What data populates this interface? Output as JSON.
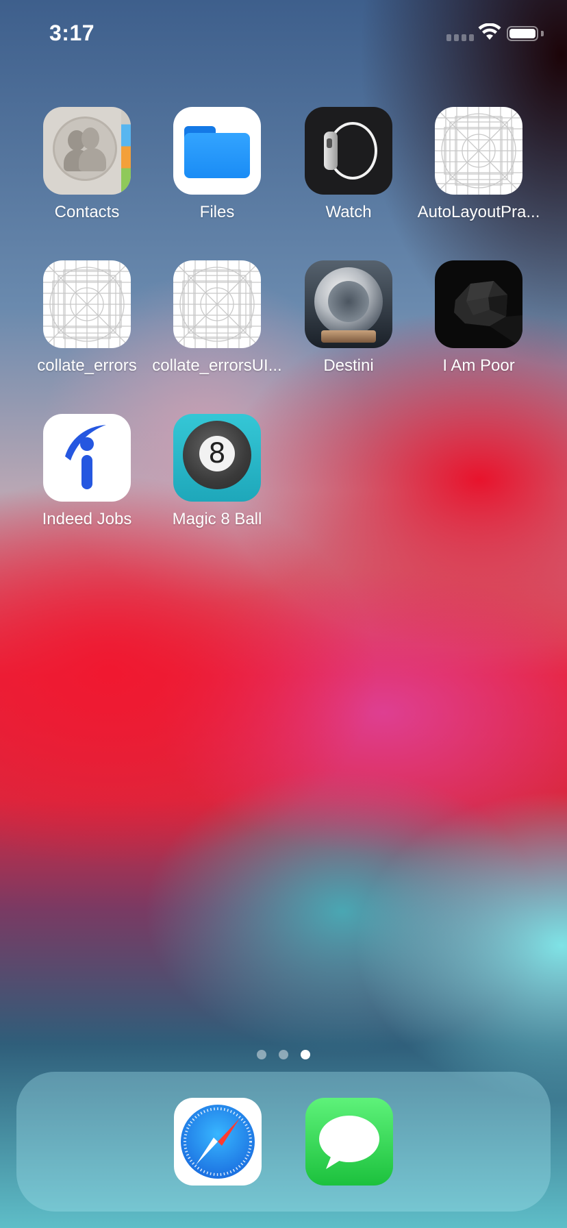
{
  "status_bar": {
    "time": "3:17",
    "battery_level": 1.0
  },
  "home": {
    "page_count": 3,
    "active_page": 3,
    "apps": [
      {
        "label": "Contacts",
        "icon": "contacts-icon"
      },
      {
        "label": "Files",
        "icon": "files-folder-icon"
      },
      {
        "label": "Watch",
        "icon": "watch-icon"
      },
      {
        "label": "AutoLayoutPra...",
        "icon": "placeholder-grid-icon"
      },
      {
        "label": "collate_errors",
        "icon": "placeholder-grid-icon"
      },
      {
        "label": "collate_errorsUI...",
        "icon": "placeholder-grid-icon"
      },
      {
        "label": "Destini",
        "icon": "crystal-ball-icon"
      },
      {
        "label": "I Am Poor",
        "icon": "coal-rock-icon"
      },
      {
        "label": "Indeed Jobs",
        "icon": "indeed-icon"
      },
      {
        "label": "Magic 8 Ball",
        "icon": "magic-8-ball-icon"
      }
    ]
  },
  "dock": {
    "apps": [
      {
        "name": "Safari",
        "icon": "safari-compass-icon"
      },
      {
        "name": "Messages",
        "icon": "messages-bubble-icon"
      }
    ]
  },
  "colors": {
    "files_blue": "#1a8cf5",
    "messages_green": "#2fd158",
    "safari_blue": "#1b7ff0",
    "magic8_teal": "#28b6c8",
    "indeed_blue": "#2557e0"
  }
}
